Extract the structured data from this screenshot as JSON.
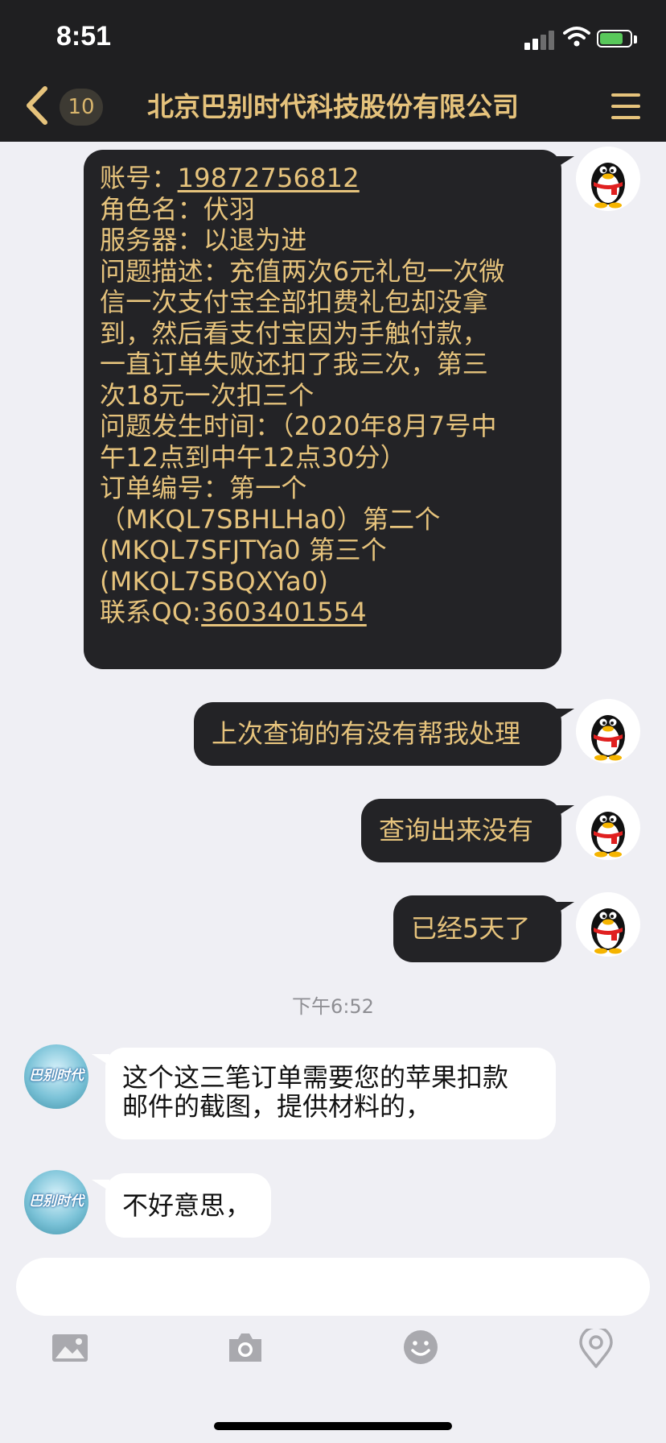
{
  "status_bar": {
    "time": "8:51"
  },
  "header": {
    "unread_count": "10",
    "title": "北京巴别时代科技股份有限公司"
  },
  "messages": {
    "m1": {
      "account_label": "账号：",
      "account_value": "19872756812",
      "role_line": "角色名：伏羽",
      "server_line": "服务器：以退为进",
      "issue_line1": "问题描述：充值两次6元礼包一次微",
      "issue_line2": "信一次支付宝全部扣费礼包却没拿",
      "issue_line3": "到，然后看支付宝因为手触付款，",
      "issue_line4": "一直订单失败还扣了我三次，第三",
      "issue_line5": "次18元一次扣三个",
      "time_line1": "问题发生时间：（2020年8月7号中",
      "time_line2": "午12点到中午12点30分）",
      "order_line1": "订单编号：第一个",
      "order_line2": "（MKQL7SBHLHa0）第二个",
      "order_line3": "(MKQL7SFJTYa0 第三个",
      "order_line4": "(MKQL7SBQXYa0)",
      "qq_label": "联系QQ:",
      "qq_value": "3603401554"
    },
    "m2": "上次查询的有没有帮我处理",
    "m3": "查询出来没有",
    "m4": "已经5天了",
    "timestamp": "下午6:52",
    "r1_line1": "这个这三笔订单需要您的苹果扣款",
    "r1_line2": "邮件的截图，提供材料的，",
    "r2": "不好意思，",
    "bot_avatar_text": "巴别时代"
  },
  "icons": {
    "back": "chevron-left-icon",
    "menu": "hamburger-menu-icon",
    "toolbar": [
      "image-icon",
      "camera-icon",
      "emoji-icon",
      "location-icon"
    ]
  },
  "colors": {
    "header_bg": "#1f1f21",
    "accent_gold": "#e6c37c",
    "bubble_out_bg": "#232326",
    "chat_bg": "#efeff4",
    "bubble_in_bg": "#ffffff"
  }
}
